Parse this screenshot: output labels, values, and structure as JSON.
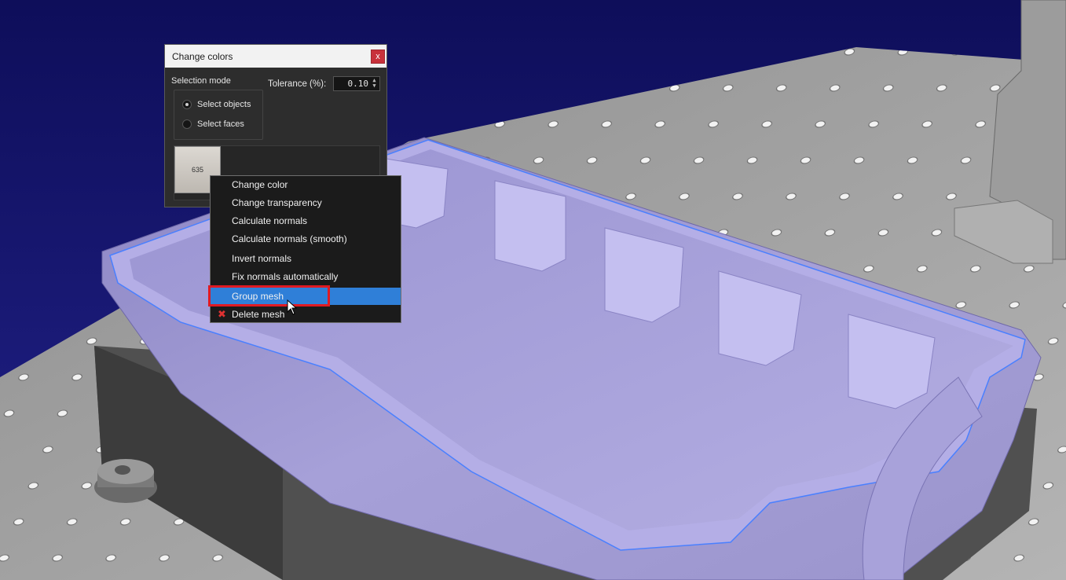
{
  "dialog": {
    "title": "Change colors",
    "close_label": "x",
    "selection_mode_label": "Selection mode",
    "radio_options": [
      {
        "label": "Select objects",
        "checked": true
      },
      {
        "label": "Select faces",
        "checked": false
      }
    ],
    "tolerance_label": "Tolerance (%):",
    "tolerance_value": "0.10",
    "swatch_label": "635",
    "swatch_color": "#d0ccc6"
  },
  "context_menu": {
    "items": [
      {
        "label": "Change color"
      },
      {
        "label": "Change transparency"
      },
      {
        "label": "Calculate normals"
      },
      {
        "label": "Calculate normals (smooth)"
      },
      {
        "label": "Invert normals"
      },
      {
        "label": "Fix normals automatically"
      },
      {
        "label": "Group mesh",
        "hovered": true
      },
      {
        "label": "Delete mesh",
        "icon": "delete-x-icon"
      }
    ]
  },
  "colors": {
    "background": "#14146a",
    "table": "#a8a8a8",
    "part": "#a29cd6",
    "edge_highlight": "#3c78ff",
    "menu_hover": "#2f7fd8",
    "annotation": "#e01a22"
  }
}
